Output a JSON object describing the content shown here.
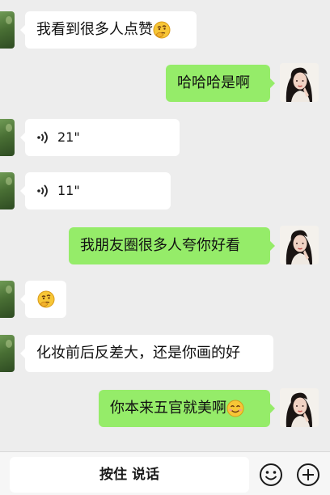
{
  "messages": [
    {
      "side": "in",
      "type": "text",
      "text": "我看到很多人点赞",
      "emoji": "thinking-face"
    },
    {
      "side": "out",
      "type": "text",
      "text": "哈哈哈是啊"
    },
    {
      "side": "in",
      "type": "voice",
      "duration": "21\""
    },
    {
      "side": "in",
      "type": "voice",
      "duration": "11\""
    },
    {
      "side": "out",
      "type": "text",
      "text": "我朋友圈很多人夸你好看"
    },
    {
      "side": "in",
      "type": "emoji",
      "emoji": "thinking-face"
    },
    {
      "side": "in",
      "type": "text",
      "text": "化妆前后反差大，还是你画的好"
    },
    {
      "side": "out",
      "type": "text",
      "text": "你本来五官就美啊",
      "emoji": "smiling-face"
    }
  ],
  "input_bar": {
    "hold_to_talk_label": "按住 说话",
    "left_icon": "emoji-icon",
    "right_icon": "plus-icon"
  },
  "colors": {
    "background": "#ededed",
    "incoming_bubble": "#ffffff",
    "outgoing_bubble": "#95ec69"
  }
}
